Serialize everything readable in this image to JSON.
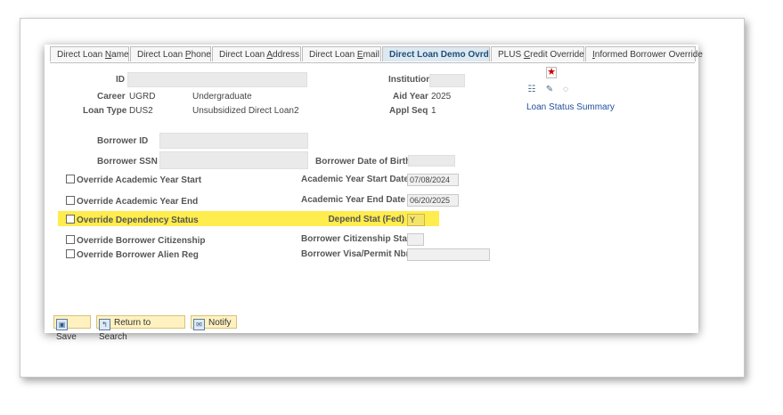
{
  "tabs": [
    {
      "pre": "Direct Loan ",
      "u": "N",
      "post": "ame"
    },
    {
      "pre": "Direct Loan ",
      "u": "P",
      "post": "hone"
    },
    {
      "pre": "Direct Loan ",
      "u": "A",
      "post": "ddress"
    },
    {
      "pre": "Direct Loan ",
      "u": "E",
      "post": "mail"
    },
    {
      "pre": "Direct Loan Demo Ovrd",
      "u": "",
      "post": ""
    },
    {
      "pre": "PLUS ",
      "u": "C",
      "post": "redit Override"
    },
    {
      "pre": "",
      "u": "I",
      "post": "nformed Borrower Override"
    }
  ],
  "header": {
    "id_label": "ID",
    "institution_label": "Institution",
    "career_label": "Career",
    "career_code": "UGRD",
    "career_desc": "Undergraduate",
    "aid_year_label": "Aid Year",
    "aid_year": "2025",
    "loan_type_label": "Loan Type",
    "loan_type_code": "DUS2",
    "loan_type_desc": "Unsubsidized Direct Loan2",
    "appl_seq_label": "Appl Seq",
    "appl_seq": "1",
    "loan_status_link": "Loan Status Summary"
  },
  "borrower": {
    "id_label": "Borrower ID",
    "ssn_label": "Borrower SSN",
    "dob_label": "Borrower Date of Birth"
  },
  "overrides": [
    {
      "label": "Override Academic Year Start",
      "field_label": "Academic Year Start Date",
      "value": "07/08/2024"
    },
    {
      "label": "Override Academic Year End",
      "field_label": "Academic Year End Date",
      "value": "06/20/2025"
    },
    {
      "label": "Override Dependency Status",
      "field_label": "Depend Stat (Fed)",
      "value": "Y"
    },
    {
      "label": "Override Borrower Citizenship",
      "field_label": "Borrower Citizenship Stat",
      "value": ""
    },
    {
      "label": "Override Borrower Alien Reg",
      "field_label": "Borrower Visa/Permit Nbr",
      "value": ""
    }
  ],
  "toolbar": {
    "save_label": "Save",
    "return_label": "Return to Search",
    "notify_label": "Notify"
  },
  "colors": {
    "highlight": "#ffec4d",
    "active_tab": "#dde8f1",
    "link": "#1f4e9c",
    "button": "#fff2c0"
  }
}
